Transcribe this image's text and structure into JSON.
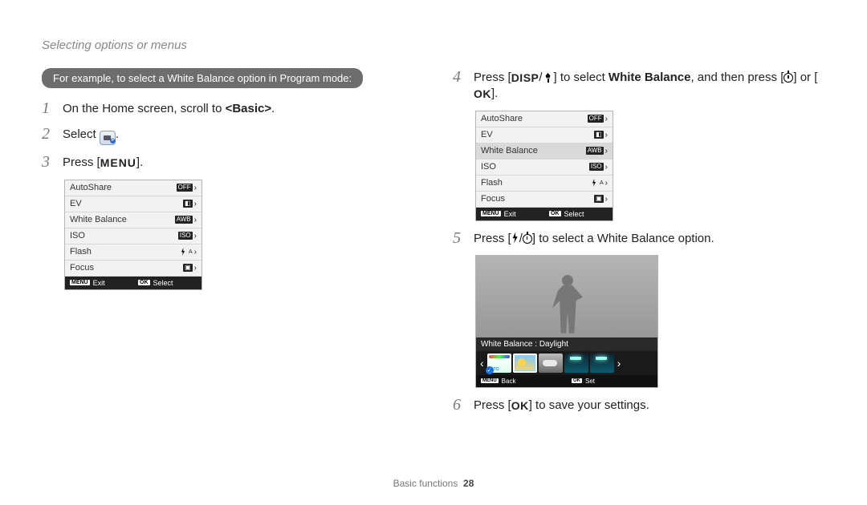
{
  "header": {
    "title": "Selecting options or menus"
  },
  "callout": "For example, to select a White Balance option in Program mode:",
  "steps": {
    "s1": {
      "pre": "On the Home screen, scroll to ",
      "bold": "<Basic>",
      "post": "."
    },
    "s2": {
      "pre": "Select ",
      "post": "."
    },
    "s3": {
      "pre": "Press [",
      "btn": "MENU",
      "post": "]."
    },
    "s4": {
      "pre": "Press [",
      "btn1": "DISP",
      "mid": "] to select ",
      "bold": "White Balance",
      "mid2": ", and then press [",
      "or": "] or [",
      "btn2": "OK",
      "post": "]."
    },
    "s5": {
      "pre": "Press [",
      "post": "] to select a White Balance option."
    },
    "s6": {
      "pre": "Press [",
      "btn": "OK",
      "post": "] to save your settings."
    }
  },
  "menu": {
    "items": [
      "AutoShare",
      "EV",
      "White Balance",
      "ISO",
      "Flash",
      "Focus"
    ],
    "exit": "Exit",
    "select": "Select",
    "menu_tag": "MENU",
    "ok_tag": "OK"
  },
  "wb_preview": {
    "label": "White Balance : Daylight",
    "back": "Back",
    "set": "Set",
    "menu_tag": "MENU",
    "ok_tag": "OK"
  },
  "footer": {
    "section": "Basic functions",
    "page": "28"
  }
}
